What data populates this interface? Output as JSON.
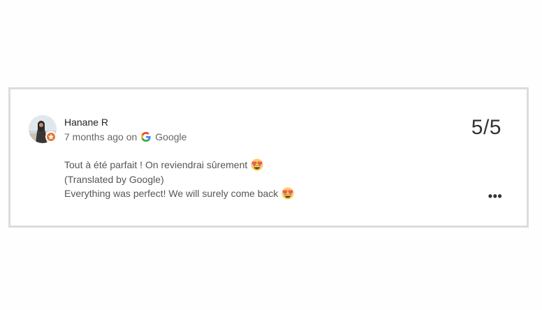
{
  "review": {
    "reviewer_name": "Hanane R",
    "time_text": "7 months ago on",
    "source": "Google",
    "rating": "5/5",
    "original_text": "Tout à été parfait ! On reviendrai sûrement",
    "translated_note": "(Translated by Google)",
    "translated_text": "Everything was perfect! We will surely come back",
    "emoji": "heart-eyes-emoji",
    "more_label": "•••"
  },
  "colors": {
    "card_border": "#dcdcdc",
    "local_guide_badge": "#e8722c",
    "name_text": "#222222",
    "meta_text": "#666666",
    "body_text": "#555555"
  }
}
